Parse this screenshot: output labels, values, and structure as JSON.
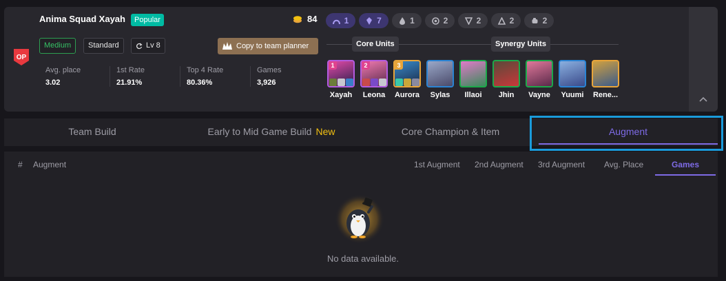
{
  "comp": {
    "title": "Anima Squad Xayah",
    "badge": "Popular",
    "tags": [
      "Medium",
      "Standard"
    ],
    "level": "Lv 8",
    "planner_button": "Copy to team planner",
    "stats": [
      {
        "label": "Avg. place",
        "value": "3.02"
      },
      {
        "label": "1st Rate",
        "value": "21.91%"
      },
      {
        "label": "Top 4 Rate",
        "value": "80.36%"
      },
      {
        "label": "Games",
        "value": "3,926"
      }
    ],
    "gold": "84",
    "traits": [
      {
        "icon": "arch-trait-icon",
        "count": "1",
        "color": "#a79af0"
      },
      {
        "icon": "crystal-trait-icon",
        "count": "7",
        "color": "#a79af0"
      },
      {
        "icon": "flame-trait-icon",
        "count": "1",
        "color": "#b9b8c0"
      },
      {
        "icon": "orb-trait-icon",
        "count": "2",
        "color": "#b9b8c0"
      },
      {
        "icon": "shield-trait-icon",
        "count": "2",
        "color": "#b9b8c0"
      },
      {
        "icon": "triangle-trait-icon",
        "count": "2",
        "color": "#b9b8c0"
      },
      {
        "icon": "fist-trait-icon",
        "count": "2",
        "color": "#b9b8c0"
      }
    ],
    "core_label": "Core Units",
    "synergy_label": "Synergy Units",
    "units": [
      {
        "name": "Xayah",
        "star": "1",
        "star_color": "#e0438f",
        "border": "c4",
        "colors": [
          "#e24aa8",
          "#2a1f4a"
        ],
        "items": [
          "#6b7c3a",
          "#c8c8d0",
          "#3a7ec8"
        ]
      },
      {
        "name": "Leona",
        "star": "2",
        "star_color": "#e0438f",
        "border": "c4",
        "colors": [
          "#f07ab0",
          "#5a2a4a"
        ],
        "items": [
          "#c84a4a",
          "#7a4ac8",
          "#c8c8d0"
        ]
      },
      {
        "name": "Aurora",
        "star": "3",
        "star_color": "#e8a53a",
        "border": "c5",
        "colors": [
          "#3a8ac8",
          "#1a2a4a"
        ],
        "items": [
          "#3ac8a8",
          "#c8a83a",
          "#8a8aa0"
        ]
      },
      {
        "name": "Sylas",
        "star": "",
        "star_color": "",
        "border": "c3",
        "colors": [
          "#9aa8c8",
          "#4a4a6a"
        ],
        "items": []
      },
      {
        "name": "Illaoi",
        "star": "",
        "star_color": "",
        "border": "c2",
        "colors": [
          "#e07ac8",
          "#3a8a5a"
        ],
        "items": []
      },
      {
        "name": "Jhin",
        "star": "",
        "star_color": "",
        "border": "c2",
        "colors": [
          "#5a4a3a",
          "#c8383a"
        ],
        "items": []
      },
      {
        "name": "Vayne",
        "star": "",
        "star_color": "",
        "border": "c2",
        "colors": [
          "#e0789a",
          "#5a2a4a"
        ],
        "items": []
      },
      {
        "name": "Yuumi",
        "star": "",
        "star_color": "",
        "border": "c3",
        "colors": [
          "#8ab0e0",
          "#3a4a8a"
        ],
        "items": []
      },
      {
        "name": "Rene...",
        "star": "",
        "star_color": "",
        "border": "c5",
        "colors": [
          "#d0a040",
          "#3a5a8a"
        ],
        "items": []
      }
    ]
  },
  "tabs": [
    {
      "label": "Team Build",
      "badge": ""
    },
    {
      "label": "Early to Mid Game Build",
      "badge": "New"
    },
    {
      "label": "Core Champion & Item",
      "badge": ""
    },
    {
      "label": "Augment",
      "badge": ""
    }
  ],
  "table": {
    "headers": {
      "num": "#",
      "augment": "Augment",
      "a1": "1st Augment",
      "a2": "2nd Augment",
      "a3": "3rd Augment",
      "avg": "Avg. Place",
      "games": "Games"
    },
    "empty_text": "No data available."
  },
  "colors": {
    "accent": "#7e6be6",
    "highlight": "#1a9bdb",
    "popular": "#00bba3",
    "new": "#f2c011"
  }
}
